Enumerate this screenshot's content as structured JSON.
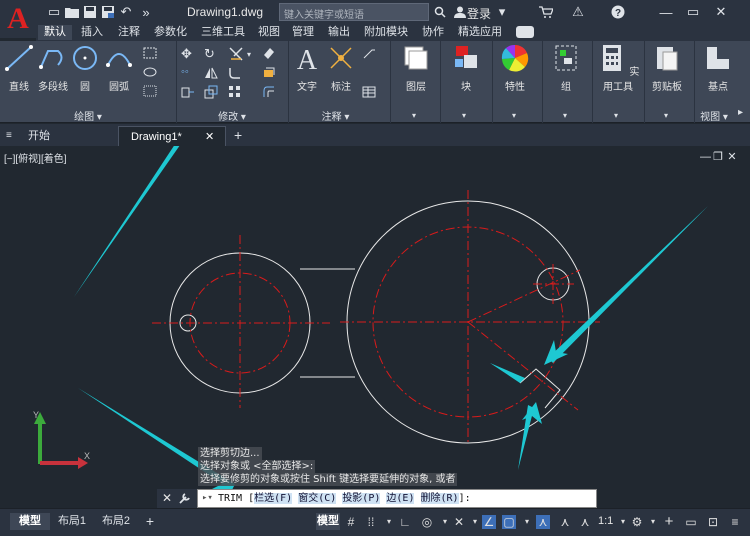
{
  "window": {
    "document_title": "Drawing1.dwg",
    "search_placeholder": "键入关键字或短语",
    "login_label": "登录"
  },
  "ribbon_tabs": [
    "默认",
    "插入",
    "注释",
    "参数化",
    "三维工具",
    "视图",
    "管理",
    "输出",
    "附加模块",
    "协作",
    "精选应用"
  ],
  "ribbon": {
    "draw": {
      "label": "绘图",
      "line": "直线",
      "polyline": "多段线",
      "circle": "圆",
      "arc": "圆弧"
    },
    "modify": {
      "label": "修改"
    },
    "annotation": {
      "label": "注释",
      "text": "文字",
      "dimension": "标注"
    },
    "layers": "图层",
    "block": "块",
    "properties": "特性",
    "group": "组",
    "utilities": "实用工具",
    "clipboard": "剪贴板",
    "base_point": "基点",
    "view": "视图"
  },
  "doc_tabs": {
    "start": "开始",
    "drawing": "Drawing1*"
  },
  "viewport_label": "[−][俯视][着色]",
  "command": {
    "history": [
      "选择剪切边...",
      "选择对象或 <全部选择>:",
      "选择要修剪的对象或按住 Shift 键选择要延伸的对象, 或者"
    ],
    "prompt": "TRIM [",
    "options": [
      "栏选(F)",
      "窗交(C)",
      "投影(P)",
      "边(E)",
      "删除(R)"
    ],
    "suffix": "]:"
  },
  "layout_tabs": [
    "模型",
    "布局1",
    "布局2"
  ],
  "status": {
    "model": "模型",
    "scale": "1:1"
  },
  "colors": {
    "accent_arrow": "#1ec8d2",
    "center_line": "#d91b1b",
    "geometry": "#e8e8e8",
    "background": "#212830"
  }
}
